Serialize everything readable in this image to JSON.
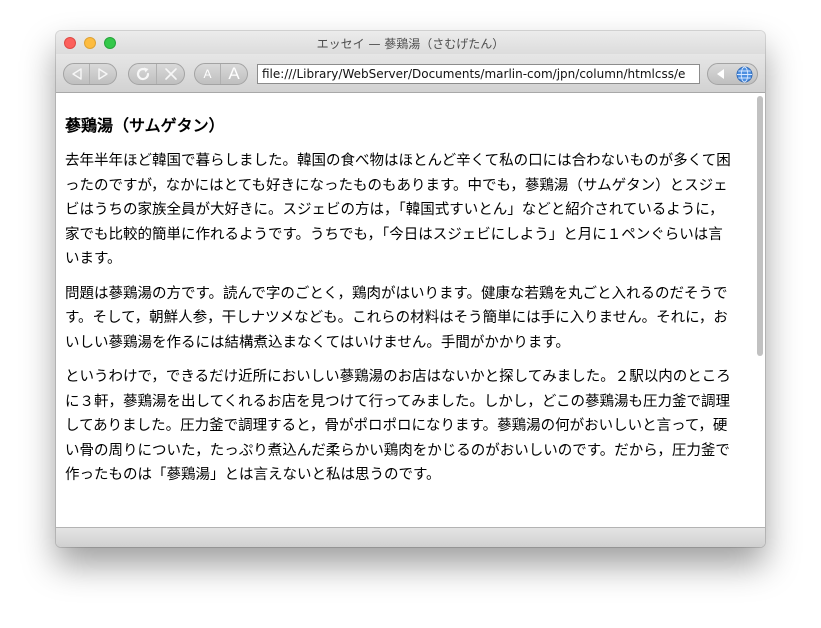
{
  "window": {
    "title": "エッセイ — 蔘鶏湯（さむげたん）"
  },
  "toolbar": {
    "back_icon": "back-arrow-icon",
    "forward_icon": "forward-arrow-icon",
    "reload_icon": "reload-icon",
    "stop_icon": "stop-icon",
    "text_smaller_label": "A",
    "text_bigger_label": "A",
    "url": "file:///Library/WebServer/Documents/marlin-com/jpn/column/htmlcss/e",
    "bookmark_icon": "bookmark-arrow-icon",
    "globe_icon": "globe-icon"
  },
  "article": {
    "heading": "蔘鶏湯（サムゲタン）",
    "paragraphs": [
      "去年半年ほど韓国で暮らしました。韓国の食べ物はほとんど辛くて私の口には合わないものが多くて困ったのですが，なかにはとても好きになったものもあります。中でも，蔘鶏湯（サムゲタン）とスジェビはうちの家族全員が大好きに。スジェビの方は，「韓国式すいとん」などと紹介されているように，家でも比較的簡単に作れるようです。うちでも，「今日はスジェビにしよう」と月に１ペンぐらいは言います。",
      "問題は蔘鶏湯の方です。読んで字のごとく，鶏肉がはいります。健康な若鶏を丸ごと入れるのだそうです。そして，朝鮮人参，干しナツメなども。これらの材料はそう簡単には手に入りません。それに，おいしい蔘鶏湯を作るには結構煮込まなくてはいけません。手間がかかります。",
      "というわけで，できるだけ近所においしい蔘鶏湯のお店はないかと探してみました。２駅以内のところに３軒，蔘鶏湯を出してくれるお店を見つけて行ってみました。しかし，どこの蔘鶏湯も圧力釜で調理してありました。圧力釜で調理すると，骨がポロポロになります。蔘鶏湯の何がおいしいと言って，硬い骨の周りについた，たっぷり煮込んだ柔らかい鶏肉をかじるのがおいしいのです。だから，圧力釜で作ったものは「蔘鶏湯」とは言えないと私は思うのです。"
    ]
  }
}
